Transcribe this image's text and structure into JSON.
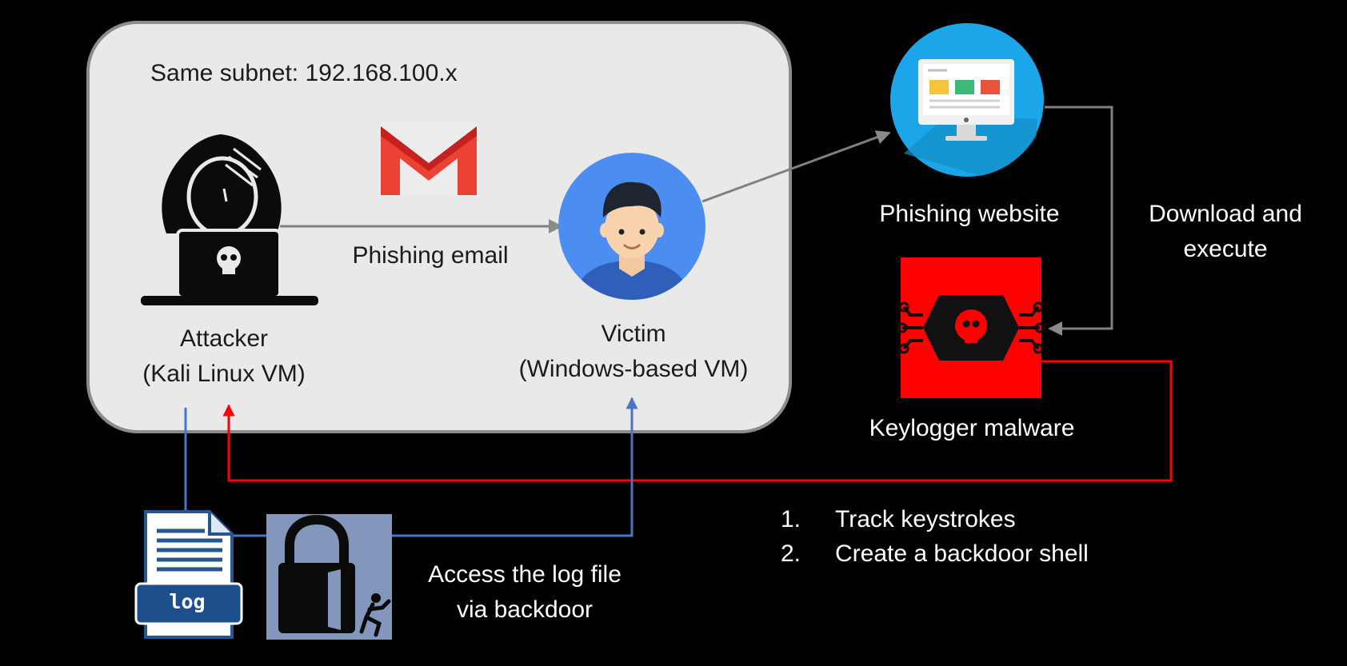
{
  "subnet_label": "Same subnet: 192.168.100.x",
  "attacker": {
    "name": "Attacker",
    "detail": "(Kali Linux VM)",
    "icon": "hacker-laptop-icon"
  },
  "victim": {
    "name": "Victim",
    "detail": "(Windows-based VM)",
    "icon": "user-avatar-icon"
  },
  "email": {
    "label": "Phishing email",
    "icon": "gmail-icon"
  },
  "website": {
    "label": "Phishing website",
    "icon": "website-monitor-icon"
  },
  "download": {
    "line1": "Download and",
    "line2": "execute"
  },
  "malware": {
    "label": "Keylogger malware",
    "icon": "malware-skull-chip-icon"
  },
  "steps": [
    {
      "num": "1.",
      "text": "Track keystrokes"
    },
    {
      "num": "2.",
      "text": "Create a backdoor shell"
    }
  ],
  "log_file": {
    "tag": "log",
    "icon": "log-file-icon"
  },
  "backdoor": {
    "line1": "Access the log file",
    "line2": "via backdoor",
    "icon": "padlock-backdoor-icon"
  },
  "colors": {
    "background": "#000000",
    "subnet_box": "#e9e9e9",
    "arrow_gray": "#7f7f7f",
    "arrow_red": "#ff0000",
    "line_blue": "#4a74c4",
    "malware_red": "#ff0000"
  }
}
